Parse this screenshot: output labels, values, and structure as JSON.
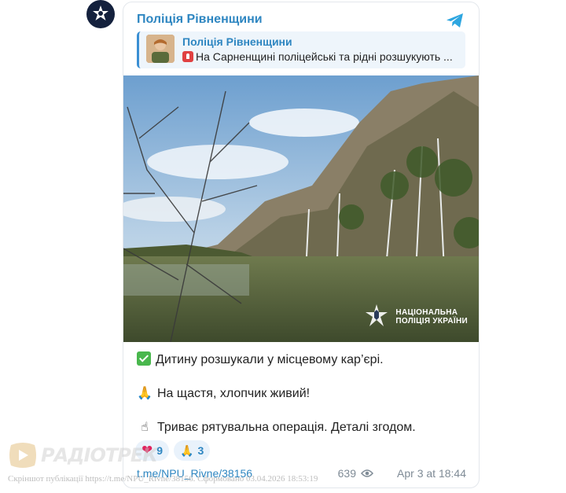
{
  "channel": {
    "name": "Поліція Рівненщини",
    "avatar_icon": "police-star-icon"
  },
  "reply": {
    "author": "Поліція Рівненщини",
    "text": "На Сарненщині поліцейські та рідні розшукують ..."
  },
  "photo": {
    "watermark_line1": "НАЦІОНАЛЬНА",
    "watermark_line2": "ПОЛІЦІЯ УКРАЇНИ"
  },
  "message": {
    "line1": "Дитину розшукали у місцевому кар’єрі.",
    "line2": "На щастя, хлопчик живий!",
    "line3": "Триває рятувальна операція. Деталі згодом."
  },
  "reactions": [
    {
      "icon": "heart-icon",
      "emoji": "❤️",
      "count": "9"
    },
    {
      "icon": "pray-icon",
      "emoji": "🙏",
      "count": "3"
    }
  ],
  "footer": {
    "link": "t.me/NPU_Rivne/38156",
    "views": "639",
    "date": "Apr 3 at 18:44"
  },
  "overlay": {
    "brand": "РАДІОТРЕК",
    "caption": "Скріншот публікації https://t.me/NPU_Rivne/38156. Сформовано 03.04.2026 18:53:19"
  },
  "colors": {
    "accent": "#2e86c1",
    "reaction_bg": "#e9f2fb",
    "reply_bg": "#eef5fb"
  }
}
